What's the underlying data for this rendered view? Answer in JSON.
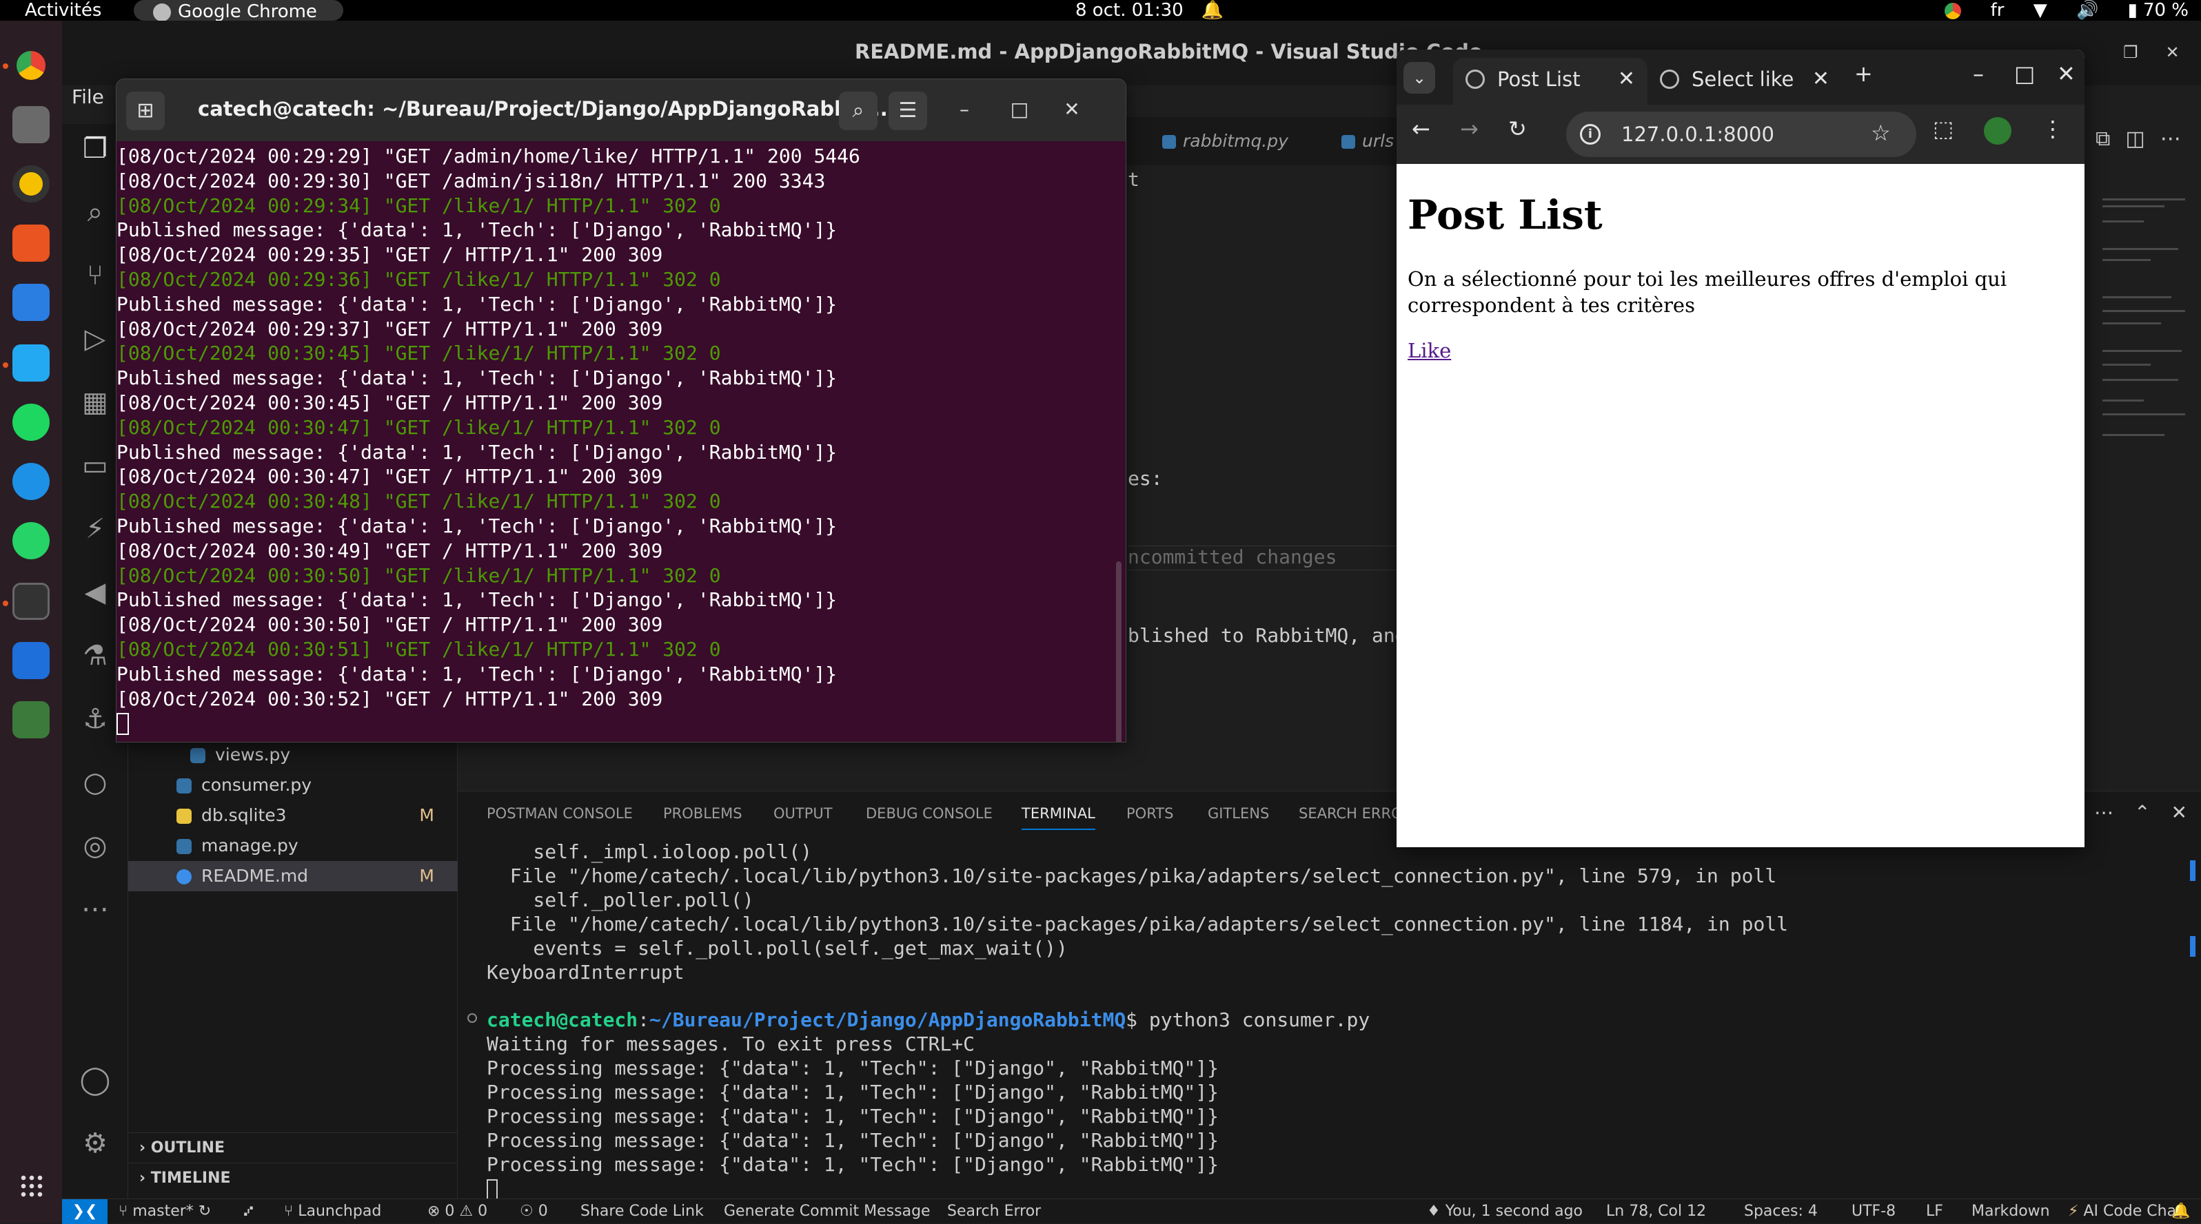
{
  "topbar": {
    "activities": "Activités",
    "active_app": "Google Chrome",
    "clock": "8 oct.  01:30",
    "lang": "fr",
    "battery": "70 %"
  },
  "vscode": {
    "title": "README.md - AppDjangoRabbitMQ - Visual Studio Code",
    "file_menu": "File",
    "tabs": [
      "rabbitmq.py",
      "urls"
    ],
    "editor_fragments": [
      "t",
      "es:",
      "ncommitted changes",
      "blished to RabbitMQ, and"
    ],
    "files": [
      {
        "name": "views.py",
        "badge": ""
      },
      {
        "name": "consumer.py",
        "badge": ""
      },
      {
        "name": "db.sqlite3",
        "badge": "M"
      },
      {
        "name": "manage.py",
        "badge": ""
      },
      {
        "name": "README.md",
        "badge": "M"
      }
    ],
    "sections": [
      "OUTLINE",
      "TIMELINE"
    ],
    "panel_tabs": [
      "POSTMAN CONSOLE",
      "PROBLEMS",
      "OUTPUT",
      "DEBUG CONSOLE",
      "TERMINAL",
      "PORTS",
      "GITLENS",
      "SEARCH ERRO"
    ],
    "terminal": {
      "pre_lines": [
        "    self._impl.ioloop.poll()",
        "  File \"/home/catech/.local/lib/python3.10/site-packages/pika/adapters/select_connection.py\", line 579, in poll",
        "    self._poller.poll()",
        "  File \"/home/catech/.local/lib/python3.10/site-packages/pika/adapters/select_connection.py\", line 1184, in poll",
        "    events = self._poll.poll(self._get_max_wait())",
        "KeyboardInterrupt"
      ],
      "prompt_user": "catech@catech",
      "prompt_sep": ":",
      "prompt_path": "~/Bureau/Project/Django/AppDjangoRabbitMQ",
      "prompt_cmd": "$ python3 consumer.py",
      "post_lines": [
        "Waiting for messages. To exit press CTRL+C",
        "Processing message: {\"data\": 1, \"Tech\": [\"Django\", \"RabbitMQ\"]}",
        "Processing message: {\"data\": 1, \"Tech\": [\"Django\", \"RabbitMQ\"]}",
        "Processing message: {\"data\": 1, \"Tech\": [\"Django\", \"RabbitMQ\"]}",
        "Processing message: {\"data\": 1, \"Tech\": [\"Django\", \"RabbitMQ\"]}",
        "Processing message: {\"data\": 1, \"Tech\": [\"Django\", \"RabbitMQ\"]}"
      ]
    },
    "status": {
      "branch": "master*",
      "launchpad": "Launchpad",
      "problems": "⊗ 0 ⚠ 0",
      "ports": "0",
      "share": "Share Code Link",
      "commit_msg": "Generate Commit Message",
      "search_error": "Search Error",
      "blame": "You, 1 second ago",
      "position": "Ln 78, Col 12",
      "spaces": "Spaces: 4",
      "encoding": "UTF-8",
      "eol": "LF",
      "language": "Markdown",
      "ai": "AI Code Chat"
    }
  },
  "terminal_window": {
    "title": "catech@catech: ~/Bureau/Project/Django/AppDjangoRabbit...",
    "lines": [
      {
        "text": "[08/Oct/2024 00:29:29] \"GET /admin/home/like/ HTTP/1.1\" 200 5446",
        "color": "white"
      },
      {
        "text": "[08/Oct/2024 00:29:30] \"GET /admin/jsi18n/ HTTP/1.1\" 200 3343",
        "color": "white"
      },
      {
        "text": "[08/Oct/2024 00:29:34] \"GET /like/1/ HTTP/1.1\" 302 0",
        "color": "green"
      },
      {
        "text": "Published message: {'data': 1, 'Tech': ['Django', 'RabbitMQ']}",
        "color": "white"
      },
      {
        "text": "[08/Oct/2024 00:29:35] \"GET / HTTP/1.1\" 200 309",
        "color": "white"
      },
      {
        "text": "[08/Oct/2024 00:29:36] \"GET /like/1/ HTTP/1.1\" 302 0",
        "color": "green"
      },
      {
        "text": "Published message: {'data': 1, 'Tech': ['Django', 'RabbitMQ']}",
        "color": "white"
      },
      {
        "text": "[08/Oct/2024 00:29:37] \"GET / HTTP/1.1\" 200 309",
        "color": "white"
      },
      {
        "text": "[08/Oct/2024 00:30:45] \"GET /like/1/ HTTP/1.1\" 302 0",
        "color": "green"
      },
      {
        "text": "Published message: {'data': 1, 'Tech': ['Django', 'RabbitMQ']}",
        "color": "white"
      },
      {
        "text": "[08/Oct/2024 00:30:45] \"GET / HTTP/1.1\" 200 309",
        "color": "white"
      },
      {
        "text": "[08/Oct/2024 00:30:47] \"GET /like/1/ HTTP/1.1\" 302 0",
        "color": "green"
      },
      {
        "text": "Published message: {'data': 1, 'Tech': ['Django', 'RabbitMQ']}",
        "color": "white"
      },
      {
        "text": "[08/Oct/2024 00:30:47] \"GET / HTTP/1.1\" 200 309",
        "color": "white"
      },
      {
        "text": "[08/Oct/2024 00:30:48] \"GET /like/1/ HTTP/1.1\" 302 0",
        "color": "green"
      },
      {
        "text": "Published message: {'data': 1, 'Tech': ['Django', 'RabbitMQ']}",
        "color": "white"
      },
      {
        "text": "[08/Oct/2024 00:30:49] \"GET / HTTP/1.1\" 200 309",
        "color": "white"
      },
      {
        "text": "[08/Oct/2024 00:30:50] \"GET /like/1/ HTTP/1.1\" 302 0",
        "color": "green"
      },
      {
        "text": "Published message: {'data': 1, 'Tech': ['Django', 'RabbitMQ']}",
        "color": "white"
      },
      {
        "text": "[08/Oct/2024 00:30:50] \"GET / HTTP/1.1\" 200 309",
        "color": "white"
      },
      {
        "text": "[08/Oct/2024 00:30:51] \"GET /like/1/ HTTP/1.1\" 302 0",
        "color": "green"
      },
      {
        "text": "Published message: {'data': 1, 'Tech': ['Django', 'RabbitMQ']}",
        "color": "white"
      },
      {
        "text": "[08/Oct/2024 00:30:52] \"GET / HTTP/1.1\" 200 309",
        "color": "white"
      }
    ]
  },
  "browser": {
    "tabs": [
      "Post List",
      "Select like"
    ],
    "url": "127.0.0.1:8000",
    "page": {
      "heading": "Post List",
      "paragraph": "On a sélectionné pour toi les meilleures offres d'emploi qui correspondent à tes critères",
      "link": "Like"
    }
  },
  "colors": {
    "terminal_bg": "#380c2a",
    "terminal_green": "#4e9a06",
    "vscode_accent": "#0078d4",
    "link_visited": "#551a8b"
  }
}
